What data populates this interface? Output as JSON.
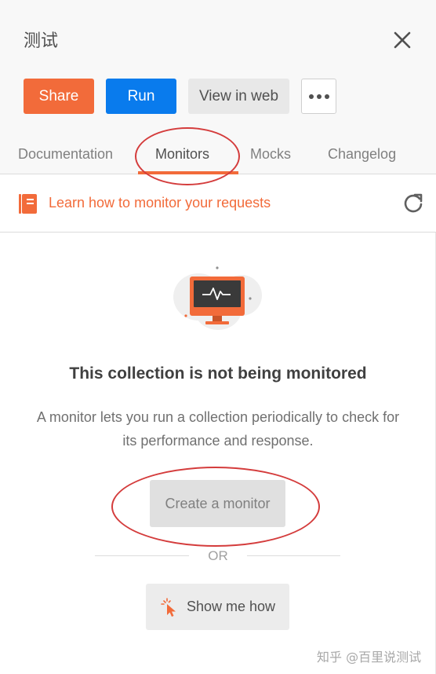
{
  "header": {
    "title": "测试",
    "buttons": {
      "share": "Share",
      "run": "Run",
      "view_in_web": "View in web"
    }
  },
  "tabs": [
    {
      "label": "Documentation",
      "active": false
    },
    {
      "label": "Monitors",
      "active": true
    },
    {
      "label": "Mocks",
      "active": false
    },
    {
      "label": "Changelog",
      "active": false
    }
  ],
  "learn": {
    "link_text": "Learn how to monitor your requests",
    "icon": "book-icon"
  },
  "empty_state": {
    "title": "This collection is not being monitored",
    "description": "A monitor lets you run a collection periodically to check for its performance and response.",
    "create_button": "Create a monitor",
    "or_text": "OR",
    "show_button": "Show me how"
  },
  "watermark": "知乎 @百里说测试",
  "colors": {
    "accent_orange": "#f26b3a",
    "primary_blue": "#097bed",
    "annotation_red": "#d43c3c"
  }
}
